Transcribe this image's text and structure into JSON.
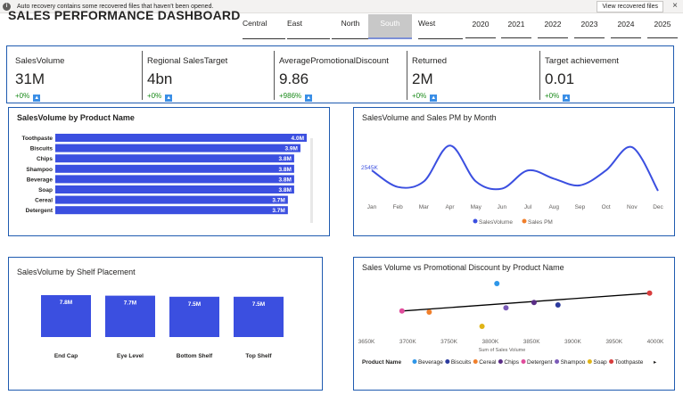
{
  "notification": {
    "icon": "info-icon",
    "message": "Auto recovery contains some recovered files that haven't been opened.",
    "view_button": "View recovered files",
    "close_glyph": "×"
  },
  "dashboard": {
    "title": "SALES PERFORMANCE DASHBOARD"
  },
  "region_slicer": {
    "options": [
      "Central",
      "East",
      "North",
      "South",
      "West"
    ],
    "selected": "South"
  },
  "year_slicer": {
    "options": [
      "2020",
      "2021",
      "2022",
      "2023",
      "2024",
      "2025"
    ]
  },
  "kpis": [
    {
      "label": "SalesVolume",
      "value": "31M",
      "change": "+0%",
      "icon": "arrow-up-icon"
    },
    {
      "label": "Regional SalesTarget",
      "value": "4bn",
      "change": "+0%",
      "icon": "arrow-up-icon"
    },
    {
      "label": "AveragePromotionalDiscount",
      "value": "9.86",
      "change": "+986%",
      "icon": "arrow-up-icon"
    },
    {
      "label": "Returned",
      "value": "2M",
      "change": "+0%",
      "icon": "arrow-up-icon"
    },
    {
      "label": "Target achievement",
      "value": "0.01",
      "change": "+0%",
      "icon": "arrow-up-icon"
    }
  ],
  "colors": {
    "accent": "#3b4fe0",
    "card_border": "#1f5bb0",
    "line_series": "#3b4fe0",
    "trend_line": "#000000",
    "positive_change": "#1a8a1a",
    "slicer_selected": "#c8c8c8"
  },
  "chart_data": [
    {
      "type": "bar",
      "orientation": "horizontal",
      "title": "SalesVolume by Product Name",
      "categories": [
        "Toothpaste",
        "Biscuits",
        "Chips",
        "Shampoo",
        "Beverage",
        "Soap",
        "Cereal",
        "Detergent"
      ],
      "values": [
        4.0,
        3.9,
        3.8,
        3.8,
        3.8,
        3.8,
        3.7,
        3.7
      ],
      "data_labels": [
        "4.0M",
        "3.9M",
        "3.8M",
        "3.8M",
        "3.8M",
        "3.8M",
        "3.7M",
        "3.7M"
      ],
      "unit": "M",
      "xlim": [
        0,
        4.0
      ]
    },
    {
      "type": "line",
      "title": "SalesVolume and Sales PM by Month",
      "categories": [
        "Jan",
        "Feb",
        "Mar",
        "Apr",
        "May",
        "Jun",
        "Jul",
        "Aug",
        "Sep",
        "Oct",
        "Nov",
        "Dec"
      ],
      "series": [
        {
          "name": "SalesVolume",
          "values": [
            2545,
            2515,
            2525,
            2590,
            2525,
            2512,
            2545,
            2530,
            2518,
            2545,
            2587,
            2508
          ]
        },
        {
          "name": "Sales PM",
          "values": []
        }
      ],
      "annotation": "2545K",
      "ylim": [
        2500,
        2600
      ],
      "legend": "bottom-center"
    },
    {
      "type": "bar",
      "title": "SalesVolume by Shelf Placement",
      "categories": [
        "End Cap",
        "Eye Level",
        "Bottom Shelf",
        "Top Shelf"
      ],
      "values": [
        7.8,
        7.7,
        7.5,
        7.5
      ],
      "data_labels": [
        "7.8M",
        "7.7M",
        "7.5M",
        "7.5M"
      ],
      "unit": "M",
      "ylim": [
        0,
        7.8
      ]
    },
    {
      "type": "scatter",
      "title": "Sales Volume vs Promotional Discount by Product Name",
      "xlabel": "Sum of Sales Volume",
      "x_ticks": [
        "3650K",
        "3700K",
        "3750K",
        "3800K",
        "3850K",
        "3900K",
        "3950K",
        "4000K"
      ],
      "xlim": [
        3650,
        4000
      ],
      "ylim": [
        9.0,
        10.6
      ],
      "legend_title": "Product Name",
      "legend": "bottom",
      "legend_more_glyph": "▸",
      "series": [
        {
          "name": "Beverage",
          "color": "#2e96e8",
          "x": 3808,
          "y": 10.45
        },
        {
          "name": "Biscuits",
          "color": "#2b3a9e",
          "x": 3882,
          "y": 9.85
        },
        {
          "name": "Cereal",
          "color": "#f07f2b",
          "x": 3726,
          "y": 9.65
        },
        {
          "name": "Chips",
          "color": "#5a2d86",
          "x": 3853,
          "y": 9.92
        },
        {
          "name": "Detergent",
          "color": "#e04c9c",
          "x": 3693,
          "y": 9.68
        },
        {
          "name": "Shampoo",
          "color": "#7b5bb8",
          "x": 3819,
          "y": 9.77
        },
        {
          "name": "Soap",
          "color": "#e0b416",
          "x": 3790,
          "y": 9.25
        },
        {
          "name": "Toothpaste",
          "color": "#d83c3c",
          "x": 3993,
          "y": 10.18
        }
      ],
      "trendline": {
        "x": [
          3693,
          3993
        ],
        "y": [
          9.68,
          10.18
        ]
      }
    }
  ]
}
